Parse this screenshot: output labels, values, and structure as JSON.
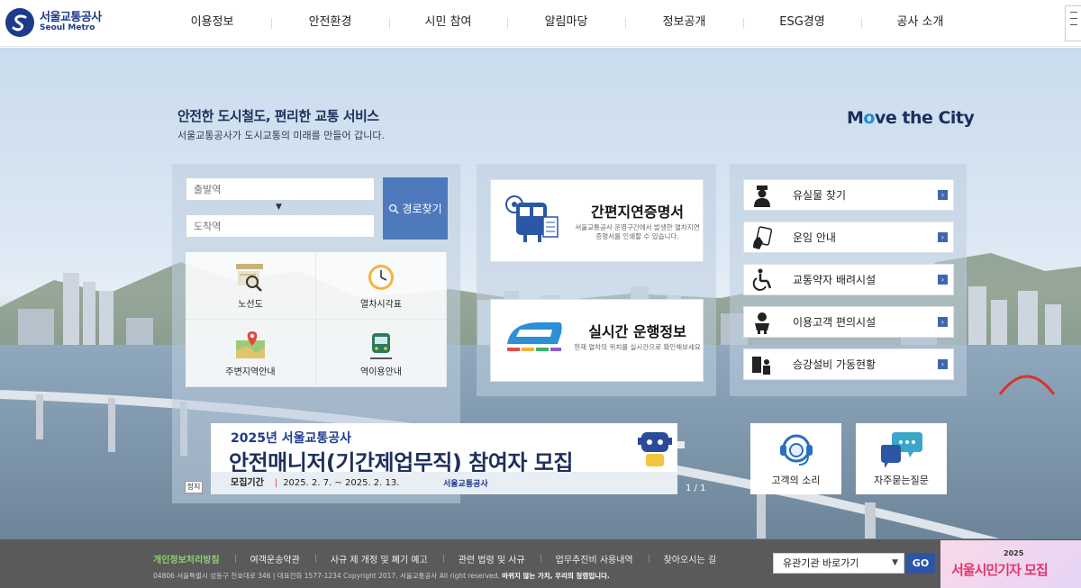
{
  "header": {
    "logo_ko": "서울교통공사",
    "logo_en": "Seoul Metro",
    "nav": [
      "이용정보",
      "안전환경",
      "시민 참여",
      "알림마당",
      "정보공개",
      "ESG경영",
      "공사 소개"
    ]
  },
  "hero": {
    "title": "안전한 도시철도, 편리한 교통 서비스",
    "subtitle": "서울교통공사가 도시교통의 미래를 만들어 갑니다.",
    "slogan_a": "M",
    "slogan_o": "o",
    "slogan_b": "ve the City"
  },
  "route": {
    "from_placeholder": "출발역",
    "to_placeholder": "도착역",
    "arrow": "▼",
    "search_label": "경로찾기"
  },
  "quick": [
    {
      "label": "노선도",
      "icon": "route-map-icon"
    },
    {
      "label": "열차시각표",
      "icon": "clock-icon"
    },
    {
      "label": "주변지역안내",
      "icon": "map-pin-icon"
    },
    {
      "label": "역이용안내",
      "icon": "train-front-icon"
    }
  ],
  "cards": {
    "certificate": {
      "title": "간편지연증명서",
      "desc": "서울교통공사 운영구간에서 발생한 열차지연증명서를 인쇄할 수 있습니다."
    },
    "realtime": {
      "title": "실시간 운행정보",
      "desc": "현재 열차의 위치를 실시간으로 확인해보세요"
    }
  },
  "services": [
    {
      "label": "유실물 찾기",
      "icon": "officer-icon"
    },
    {
      "label": "운임 안내",
      "icon": "ticket-icon"
    },
    {
      "label": "교통약자 배려시설",
      "icon": "wheelchair-icon"
    },
    {
      "label": "이용고객 편의시설",
      "icon": "baby-icon"
    },
    {
      "label": "승강설비 가동현황",
      "icon": "elevator-icon"
    }
  ],
  "banner": {
    "kicker": "2025년 서울교통공사",
    "headline": "안전매니저(기간제업무직) 참여자 모집",
    "period_label": "모집기간",
    "period": "2025. 2. 7. ~ 2025. 2. 13.",
    "brand": "서울교통공사",
    "stop_label": "정지",
    "pager": "1 / 1"
  },
  "customer": {
    "voice": "고객의 소리",
    "faq": "자주묻는질문"
  },
  "footer": {
    "links": [
      "개인정보처리방침",
      "여객운송약관",
      "사규 제 개정 및 폐기 예고",
      "관련 법령 및 사규",
      "업무추진비 사용내역",
      "찾아오시는 길"
    ],
    "address": "04806 서울특별시 성동구 천호대로 346 | 대표전화 1577-1234 Copyright 2017. 서울교통공사 All right reserved.",
    "motto": "바뀌지 않는 가치, 우리의 청렴입니다.",
    "related_select": "유관기관 바로가기",
    "go_label": "GO",
    "ad_year": "2025",
    "ad_text": "서울시민기자 모집"
  },
  "colors": {
    "brand_navy": "#1e3a8a",
    "accent_blue": "#4f79bd",
    "footer_bg": "#5a5a5a",
    "privacy_green": "#8fd16f"
  }
}
